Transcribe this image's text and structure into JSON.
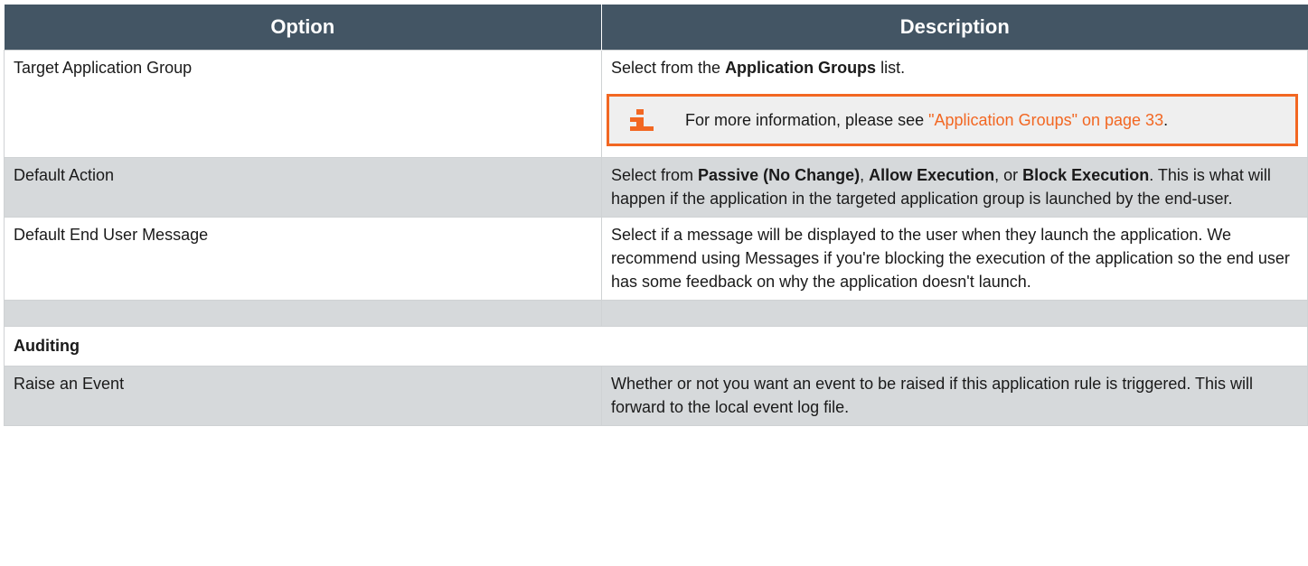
{
  "table": {
    "headers": [
      "Option",
      "Description"
    ],
    "rows": {
      "target": {
        "option": "Target Application Group",
        "desc_pre": "Select from the ",
        "desc_bold": "Application Groups",
        "desc_post": " list.",
        "note_pre": "For more information, please see ",
        "note_link": "\"Application Groups\" on page 33",
        "note_post": "."
      },
      "action": {
        "option": "Default Action",
        "desc_pre": "Select from ",
        "desc_b1": "Passive (No Change)",
        "desc_sep1": ", ",
        "desc_b2": "Allow Execution",
        "desc_sep2": ", or ",
        "desc_b3": "Block Execution",
        "desc_post": ". This is what will happen if the application in the targeted application group is launched by the end-user."
      },
      "message": {
        "option": "Default End User Message",
        "desc": "Select if a message will be displayed to the user when they launch the application. We recommend using Messages if you're blocking the execution of the application so the end user has some feedback on why the application doesn't launch."
      },
      "auditing": {
        "label": "Auditing"
      },
      "event": {
        "option": "Raise an Event",
        "desc": "Whether or not you want an event to be raised if this application rule is triggered. This will forward to the local event log file."
      }
    }
  },
  "colors": {
    "header_bg": "#435564",
    "shaded_row": "#d6d9db",
    "accent": "#f26722",
    "note_bg": "#efefef"
  },
  "icons": {
    "note": "info-icon"
  }
}
